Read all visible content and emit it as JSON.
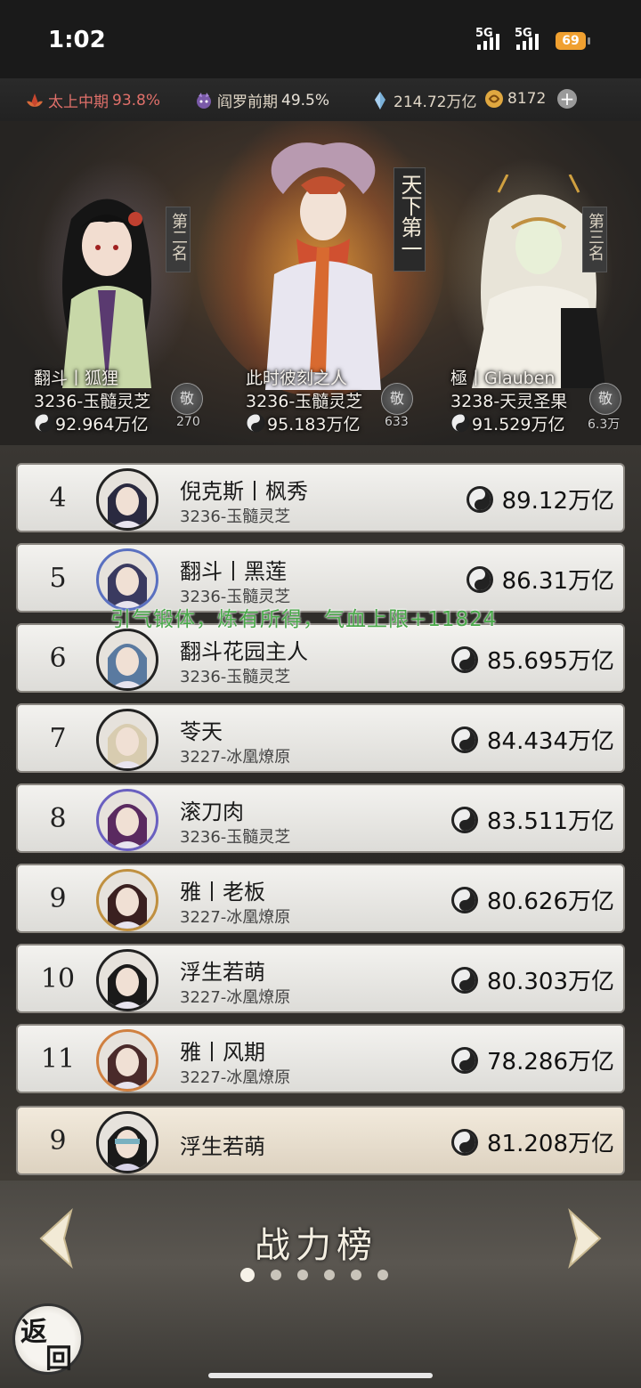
{
  "status_bar": {
    "time": "1:02",
    "net1": "5G",
    "net2": "5G",
    "battery": "69"
  },
  "resources": {
    "realm1_name": "太上中期",
    "realm1_pct": "93.8%",
    "realm2_name": "阎罗前期",
    "realm2_pct": "49.5%",
    "crystal": "214.72万亿",
    "coins": "8172"
  },
  "podium": {
    "second": {
      "banner": "第二名",
      "name": "翻斗丨狐狸",
      "server": "3236-玉髓灵芝",
      "power": "92.964万亿",
      "likes": "270",
      "like_icon": "敬"
    },
    "first": {
      "banner": "天下第一",
      "name": "此时彼刻之人",
      "server": "3236-玉髓灵芝",
      "power": "95.183万亿",
      "likes": "633",
      "like_icon": "敬"
    },
    "third": {
      "banner": "第三名",
      "name": "極丨Glauben",
      "server": "3238-天灵圣果",
      "power": "91.529万亿",
      "likes": "6.3万",
      "like_icon": "敬"
    }
  },
  "rows": [
    {
      "rank": "4",
      "name": "倪克斯丨枫秀",
      "server": "3236-玉髓灵芝",
      "power": "89.12万亿"
    },
    {
      "rank": "5",
      "name": "翻斗丨黑莲",
      "server": "3236-玉髓灵芝",
      "power": "86.31万亿"
    },
    {
      "rank": "6",
      "name": "翻斗花园主人",
      "server": "3236-玉髓灵芝",
      "power": "85.695万亿"
    },
    {
      "rank": "7",
      "name": "苓天",
      "server": "3227-冰凰燎原",
      "power": "84.434万亿"
    },
    {
      "rank": "8",
      "name": "滚刀肉",
      "server": "3236-玉髓灵芝",
      "power": "83.511万亿"
    },
    {
      "rank": "9",
      "name": "雅丨老板",
      "server": "3227-冰凰燎原",
      "power": "80.626万亿"
    },
    {
      "rank": "10",
      "name": "浮生若萌",
      "server": "3227-冰凰燎原",
      "power": "80.303万亿"
    },
    {
      "rank": "11",
      "name": "雅丨风期",
      "server": "3227-冰凰燎原",
      "power": "78.286万亿"
    }
  ],
  "self_row": {
    "rank": "9",
    "name": "浮生若萌",
    "power": "81.208万亿"
  },
  "float_message": "引气锻体，炼有所得，气血上限+11824",
  "bottom": {
    "title": "战力榜",
    "back_char1": "返",
    "back_char2": "回",
    "page_count": 6,
    "active_page": 0
  },
  "colors": {
    "realm_pct": "#e0706a",
    "float_msg": "#4aa84a",
    "battery": "#f0a030"
  }
}
